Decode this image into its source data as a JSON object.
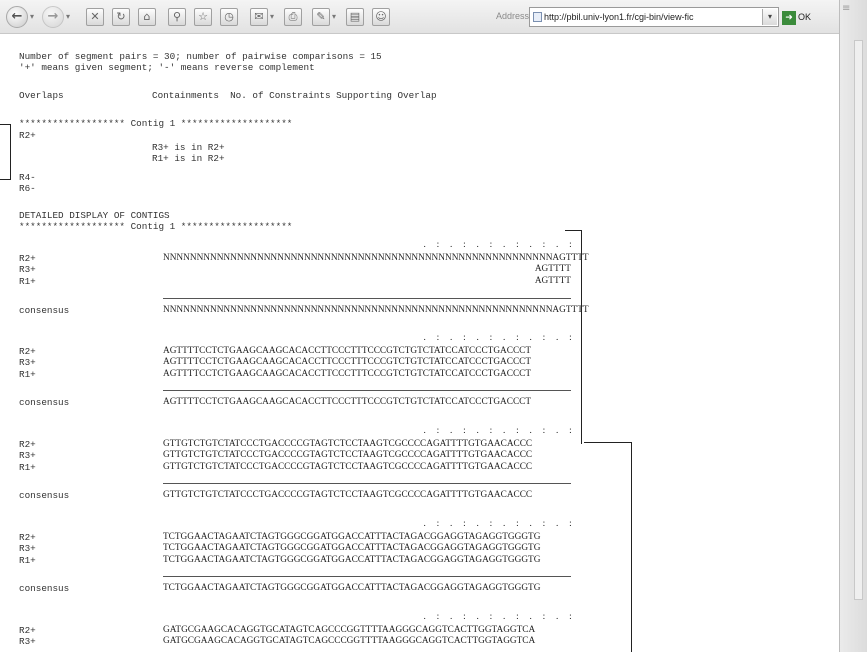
{
  "browser": {
    "address_label": "Address",
    "url": "http://pbil.univ-lyon1.fr/cgi-bin/view-fic",
    "go_label": "OK",
    "toolbar_icons": [
      "back-icon",
      "forward-icon",
      "stop-icon",
      "refresh-icon",
      "home-icon",
      "search-icon",
      "favorites-icon",
      "history-icon",
      "mail-icon",
      "print-icon",
      "edit-icon",
      "discuss-icon",
      "messenger-icon"
    ]
  },
  "header": {
    "line1": "Number of segment pairs = 30; number of pairwise comparisons = 15",
    "line2": "'+' means given segment; '-' means reverse complement"
  },
  "columns": {
    "overlaps": "Overlaps",
    "containments": "Containments  No. of Constraints Supporting Overlap"
  },
  "contig_summary": {
    "header": "******************* Contig 1 ********************",
    "row_r2": "R2+",
    "contain1": "R3+ is in R2+",
    "contain2": "R1+ is in R2+",
    "row_r4": "R4-",
    "row_r6": "R6-"
  },
  "detailed": {
    "title": "DETAILED DISPLAY OF CONTIGS",
    "contig_header": "******************* Contig 1 ********************"
  },
  "blocks": [
    {
      "ruler": ".    :    .    :    .    :    .    :    .    :    .    :",
      "labels": [
        "R2+",
        "R3+",
        "R1+"
      ],
      "seqs": [
        "NNNNNNNNNNNNNNNNNNNNNNNNNNNNNNNNNNNNNNNNNNNNNNNNNNNNNNNNNNAGTTTT",
        "AGTTTT",
        "AGTTTT"
      ],
      "consensus_label": "consensus",
      "consensus": "NNNNNNNNNNNNNNNNNNNNNNNNNNNNNNNNNNNNNNNNNNNNNNNNNNNNNNNNNNAGTTTT"
    },
    {
      "ruler": ".    :    .    :    .    :    .    :    .    :    .    :",
      "labels": [
        "R2+",
        "R3+",
        "R1+"
      ],
      "seqs": [
        "AGTTTTCCTCTGAAGCAAGCACACCTTCCCTTTCCCGTCTGTCTATCCATCCCTGACCCT",
        "AGTTTTCCTCTGAAGCAAGCACACCTTCCCTTTCCCGTCTGTCTATCCATCCCTGACCCT",
        "AGTTTTCCTCTGAAGCAAGCACACCTTCCCTTTCCCGTCTGTCTATCCATCCCTGACCCT"
      ],
      "consensus_label": "consensus",
      "consensus": "AGTTTTCCTCTGAAGCAAGCACACCTTCCCTTTCCCGTCTGTCTATCCATCCCTGACCCT"
    },
    {
      "ruler": ".    :    .    :    .    :    .    :    .    :    .    :",
      "labels": [
        "R2+",
        "R3+",
        "R1+"
      ],
      "seqs": [
        "GTTGTCTGTCTATCCCTGACCCCGTAGTCTCCTAAGTCGCCCCAGATTTTGTGAACACCC",
        "GTTGTCTGTCTATCCCTGACCCCGTAGTCTCCTAAGTCGCCCCAGATTTTGTGAACACCC",
        "GTTGTCTGTCTATCCCTGACCCCGTAGTCTCCTAAGTCGCCCCAGATTTTGTGAACACCC"
      ],
      "consensus_label": "consensus",
      "consensus": "GTTGTCTGTCTATCCCTGACCCCGTAGTCTCCTAAGTCGCCCCAGATTTTGTGAACACCC"
    },
    {
      "ruler": ".    :    .    :    .    :    .    :    .    :    .    :",
      "labels": [
        "R2+",
        "R3+",
        "R1+"
      ],
      "seqs": [
        "TCTGGAACTAGAATCTAGTGGGCGGATGGACCATTTACTAGACGGAGGTAGAGGTGGGTG",
        "TCTGGAACTAGAATCTAGTGGGCGGATGGACCATTTACTAGACGGAGGTAGAGGTGGGTG",
        "TCTGGAACTAGAATCTAGTGGGCGGATGGACCATTTACTAGACGGAGGTAGAGGTGGGTG"
      ],
      "consensus_label": "consensus",
      "consensus": "TCTGGAACTAGAATCTAGTGGGCGGATGGACCATTTACTAGACGGAGGTAGAGGTGGGTG"
    },
    {
      "ruler": ".    :    .    :    .    :    .    :    .    :    .    :",
      "labels": [
        "R2+",
        "R3+"
      ],
      "seqs": [
        "GATGCGAAGCACAGGTGCATAGTCAGCCCGGTTTTAAGGGCAGGTCACTTGGTAGGTCA",
        "GATGCGAAGCACAGGTGCATAGTCAGCCCGGTTTTAAGGGCAGGTCACTTGGTAGGTCA"
      ]
    }
  ]
}
